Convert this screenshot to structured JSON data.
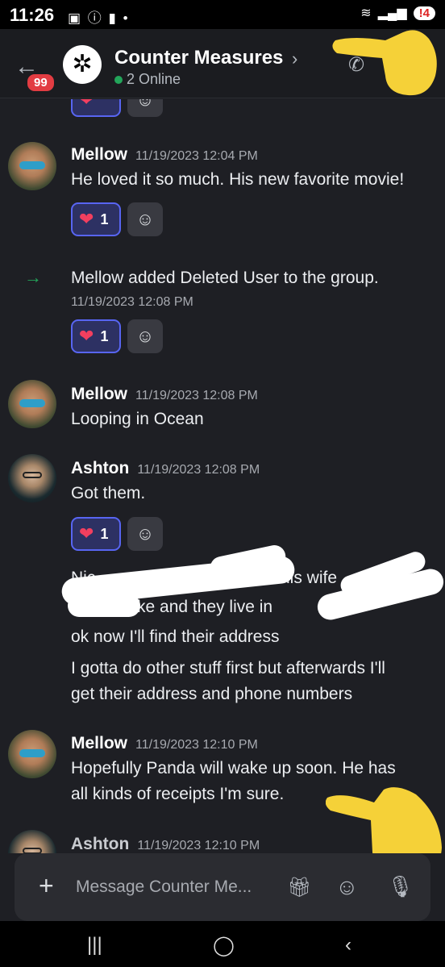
{
  "status": {
    "time": "11:26",
    "notification_count": "4"
  },
  "header": {
    "unread_badge": "99",
    "group_name": "Counter Measures",
    "online": "2 Online"
  },
  "messages": [
    {
      "user": "Mellow",
      "time": "11/19/2023 12:04 PM",
      "text": "He loved it so much.  His new favorite movie!",
      "reaction": "1"
    },
    {
      "system": "Mellow added Deleted User to the group.",
      "time": "11/19/2023 12:08 PM",
      "reaction": "1"
    },
    {
      "user": "Mellow",
      "time": "11/19/2023 12:08 PM",
      "text": "Looping in Ocean"
    },
    {
      "user": "Ashton",
      "time": "11/19/2023 12:08 PM",
      "text": "Got them.",
      "reaction": "1"
    },
    {
      "partial1": "Nic",
      "partial1b": "his wife",
      "partial2": "ke and they live in",
      "line3": "ok now I'll find their address",
      "line4a": "I gotta do other stuff first but afterwards I'll",
      "line4b": "get their address and phone numbers"
    },
    {
      "user": "Mellow",
      "time": "11/19/2023 12:10 PM",
      "text1": "Hopefully Panda will wake up soon.  He has",
      "text2": "all kinds of receipts I'm sure."
    },
    {
      "user": "Ashton",
      "time": "11/19/2023 12:10 PM"
    }
  ],
  "composer": {
    "placeholder": "Message Counter Me..."
  },
  "icons": [
    "back-arrow-icon",
    "group-icon",
    "chevron-right-icon",
    "call-icon",
    "heart-reaction-icon",
    "add-reaction-icon",
    "join-arrow-icon",
    "plus-icon",
    "gift-icon",
    "emoji-icon",
    "mic-icon"
  ],
  "colors": {
    "background": "#1e1f24",
    "accent": "#5865f2",
    "online": "#23a55a",
    "badge": "#e23c42"
  }
}
